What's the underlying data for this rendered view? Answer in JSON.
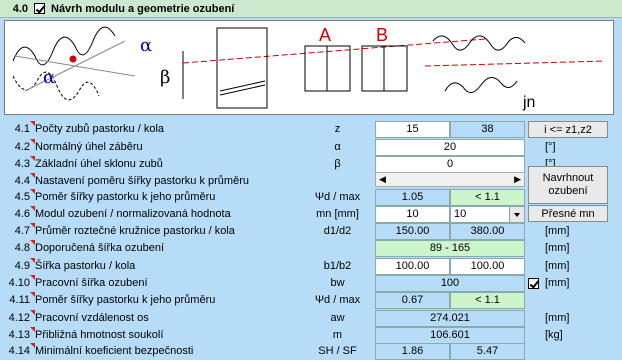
{
  "header": {
    "number": "4.0",
    "title": "Návrh modulu a geometrie ozubení"
  },
  "diagram": {
    "labelA": "A",
    "labelB": "B",
    "alpha": "α",
    "beta": "β",
    "jn": "jn"
  },
  "rows": [
    {
      "num": "4.1",
      "label": "Počty zubů pastorku / kola",
      "sym": "z",
      "v1": "15",
      "v2": "38"
    },
    {
      "num": "4.2",
      "label": "Normálný úhel záběru",
      "sym": "α",
      "v": "20",
      "unit": "[°]"
    },
    {
      "num": "4.3",
      "label": "Základní úhel sklonu zubů",
      "sym": "β",
      "v": "0",
      "unit": "[°]"
    },
    {
      "num": "4.4",
      "label": "Nastavení poměru šířky pastorku k průměru"
    },
    {
      "num": "4.5",
      "label": "Poměr šířky pastorku k jeho průměru",
      "sym": "Ψd / max",
      "v1": "1.05",
      "v2": "< 1.1"
    },
    {
      "num": "4.6",
      "label": "Modul ozubení / normalizovaná hodnota",
      "sym": "mn [mm]",
      "v1": "10",
      "v2": "10"
    },
    {
      "num": "4.7",
      "label": "Průměr roztečné kružnice pastorku / kola",
      "sym": "d1/d2",
      "v1": "150.00",
      "v2": "380.00",
      "unit": "[mm]"
    },
    {
      "num": "4.8",
      "label": "Doporučená šířka ozubení",
      "v": "89 - 165",
      "unit": "[mm]"
    },
    {
      "num": "4.9",
      "label": "Šířka pastorku / kola",
      "sym": "b1/b2",
      "v1": "100.00",
      "v2": "100.00",
      "unit": "[mm]"
    },
    {
      "num": "4.10",
      "label": "Pracovní šířka ozubení",
      "sym": "bw",
      "v": "100",
      "unit": "[mm]"
    },
    {
      "num": "4.11",
      "label": "Poměr šířky pastorku k jeho průměru",
      "sym": "Ψd / max",
      "v1": "0.67",
      "v2": "< 1.1"
    },
    {
      "num": "4.12",
      "label": "Pracovní vzdálenost os",
      "sym": "aw",
      "v": "274.021",
      "unit": "[mm]"
    },
    {
      "num": "4.13",
      "label": "Přibližná hmotnost soukolí",
      "sym": "m",
      "v": "106.601",
      "unit": "[kg]"
    },
    {
      "num": "4.14",
      "label": "Minimální koeficient bezpečnosti",
      "sym": "SH / SF",
      "v1": "1.86",
      "v2": "5.47"
    }
  ],
  "buttons": {
    "i_label": "i <= z1,z2",
    "navrhnout": "Navrhnout ozubení",
    "presne": "Přesné mn"
  }
}
